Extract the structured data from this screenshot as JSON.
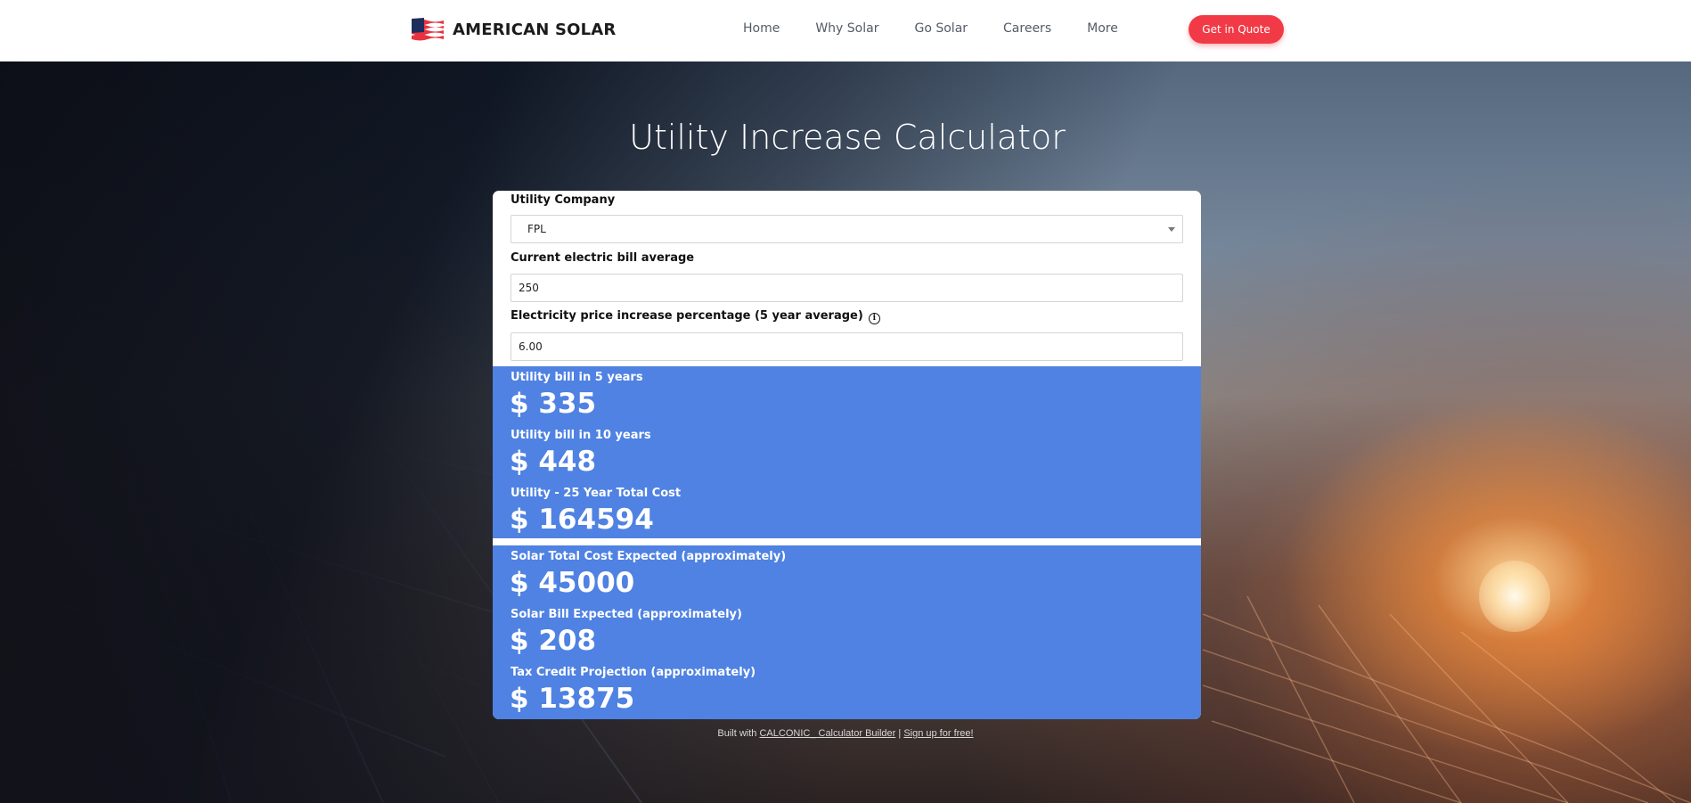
{
  "header": {
    "brand": "AMERICAN SOLAR",
    "nav": [
      "Home",
      "Why Solar",
      "Go Solar",
      "Careers",
      "More"
    ],
    "cta_label": "Get in Quote"
  },
  "calculator": {
    "title": "Utility Increase Calculator",
    "utility_company": {
      "label": "Utility Company",
      "value": "FPL"
    },
    "bill_average": {
      "label": "Current electric bill average",
      "value": "250"
    },
    "increase_pct": {
      "label": "Electricity price increase percentage (5 year average)",
      "value": "6.00",
      "info_glyph": "i"
    },
    "utility_results": [
      {
        "label": "Utility bill in 5 years",
        "value": "$ 335"
      },
      {
        "label": "Utility bill in 10 years",
        "value": "$ 448"
      },
      {
        "label": "Utility - 25 Year Total Cost",
        "value": "$ 164594"
      }
    ],
    "solar_results": [
      {
        "label": "Solar Total Cost Expected (approximately)",
        "value": "$ 45000"
      },
      {
        "label": "Solar Bill Expected (approximately)",
        "value": "$ 208"
      },
      {
        "label": "Tax Credit Projection (approximately)",
        "value": "$ 13875"
      }
    ]
  },
  "footer": {
    "prefix": "Built with ",
    "link1": "CALCONIC_ Calculator Builder",
    "separator": " | ",
    "link2": "Sign up for free!"
  },
  "colors": {
    "accent_button": "#f23a47",
    "results_blue": "#4f82e2",
    "flag_red": "#e8333f",
    "flag_navy": "#1f2d5c"
  },
  "icons": [
    "flag-logo-icon",
    "info-icon",
    "chevron-down-icon"
  ]
}
